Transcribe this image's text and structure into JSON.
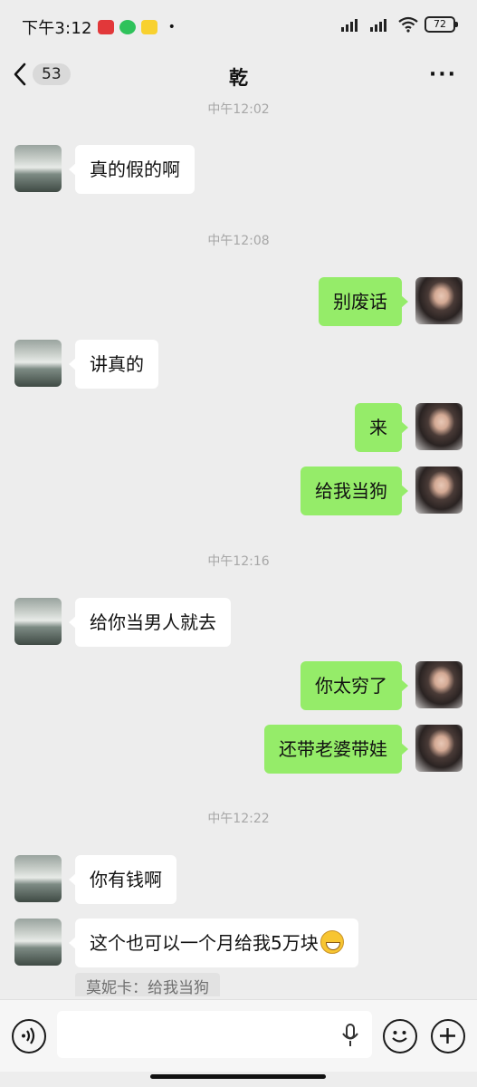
{
  "status_bar": {
    "time": "下午3:12",
    "apps": [
      "红包",
      "微信",
      "美团"
    ],
    "battery": "72"
  },
  "header": {
    "unread_count": "53",
    "title": "乾"
  },
  "messages": [
    {
      "kind": "timestamp",
      "text": "中午12:02"
    },
    {
      "kind": "in",
      "text": "真的假的啊"
    },
    {
      "kind": "timestamp",
      "text": "中午12:08"
    },
    {
      "kind": "out",
      "text": "别废话"
    },
    {
      "kind": "in",
      "text": "讲真的"
    },
    {
      "kind": "out",
      "text": "来"
    },
    {
      "kind": "out",
      "text": "给我当狗"
    },
    {
      "kind": "timestamp",
      "text": "中午12:16"
    },
    {
      "kind": "in",
      "text": "给你当男人就去"
    },
    {
      "kind": "out",
      "text": "你太穷了"
    },
    {
      "kind": "out",
      "text": "还带老婆带娃"
    },
    {
      "kind": "timestamp",
      "text": "中午12:22"
    },
    {
      "kind": "in",
      "text": "你有钱啊"
    },
    {
      "kind": "in",
      "text": "这个也可以一个月给我5万块",
      "emoji": "grin-emoji"
    }
  ],
  "quote": "莫妮卡：给我当狗",
  "colors": {
    "background": "#ededed",
    "bubble_out": "#95ec69",
    "bubble_in": "#ffffff",
    "timestamp": "#a7a7a7"
  },
  "icons": [
    "back-chevron-icon",
    "more-icon",
    "voice-icon",
    "mic-icon",
    "emoji-icon",
    "plus-icon"
  ]
}
